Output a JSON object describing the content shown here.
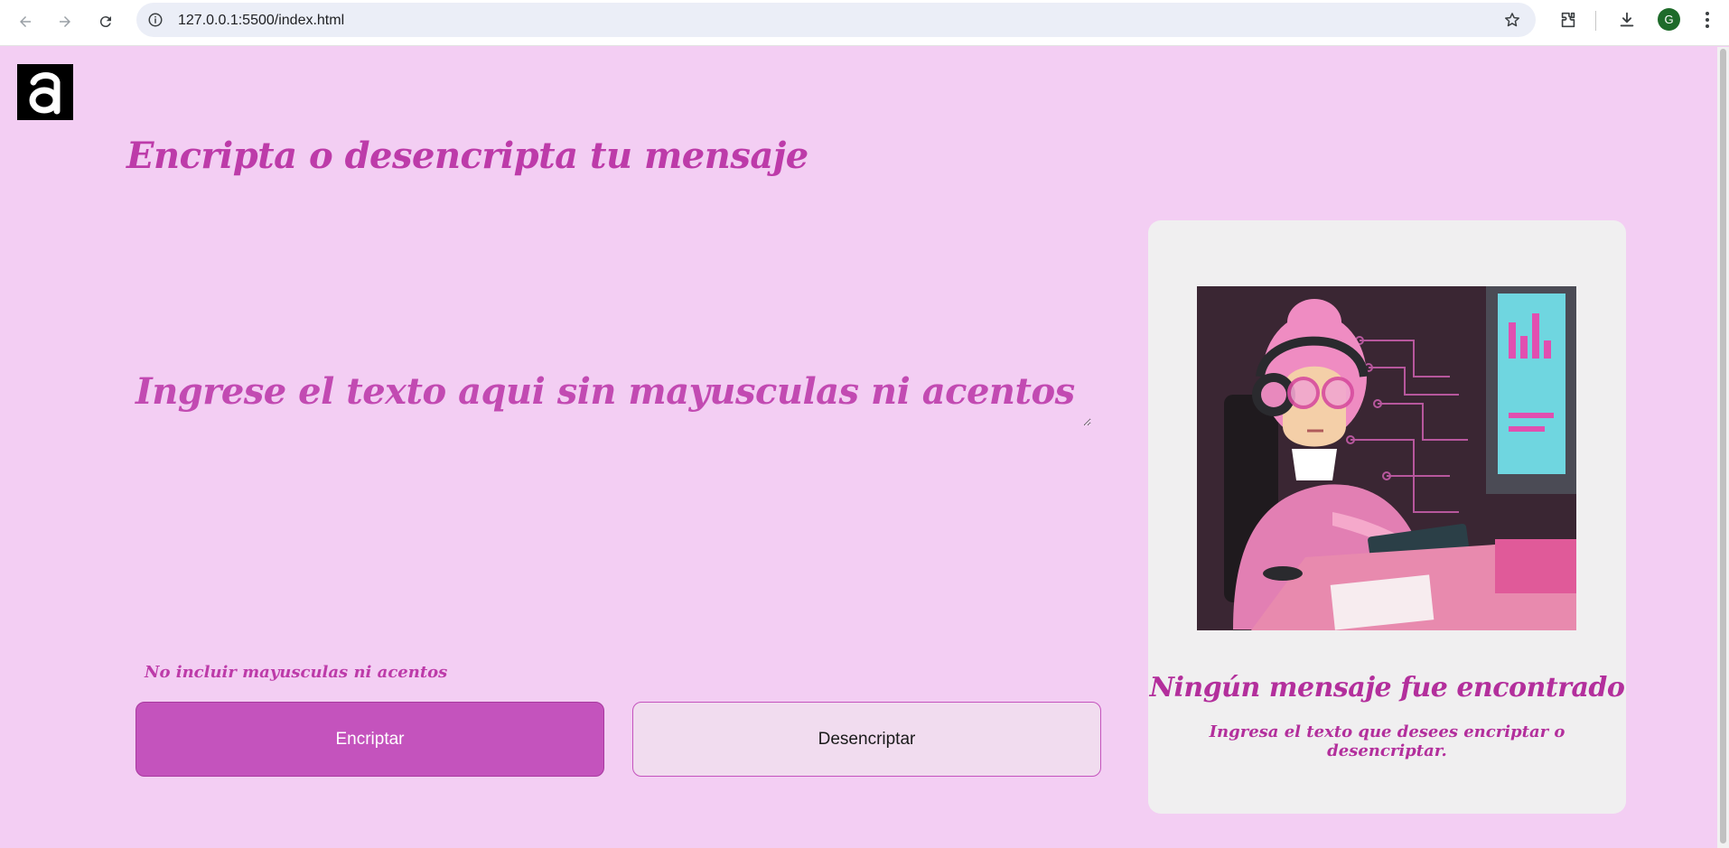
{
  "browser": {
    "url": "127.0.0.1:5500/index.html",
    "avatar_letter": "G",
    "icons": [
      "back-arrow-icon",
      "forward-arrow-icon",
      "reload-icon",
      "site-info-icon",
      "bookmark-star-icon",
      "extensions-icon",
      "download-icon",
      "more-vert-icon"
    ]
  },
  "page": {
    "logo_glyph": "a",
    "title": "Encripta o desencripta tu mensaje",
    "input": {
      "placeholder": "Ingrese el texto aqui sin mayusculas ni acentos",
      "value": ""
    },
    "hint": "No incluir mayusculas ni acentos",
    "buttons": {
      "encrypt_label": "Encriptar",
      "decrypt_label": "Desencriptar"
    },
    "output_panel": {
      "title": "Ningún mensaje fue encontrado",
      "subtitle": "Ingresa el texto que desees encriptar o desencriptar."
    }
  },
  "colors": {
    "page_background": "#f3cef3",
    "accent": "#c453bd",
    "text_accent": "#bd3ba9",
    "panel_background": "#f0eff0"
  }
}
